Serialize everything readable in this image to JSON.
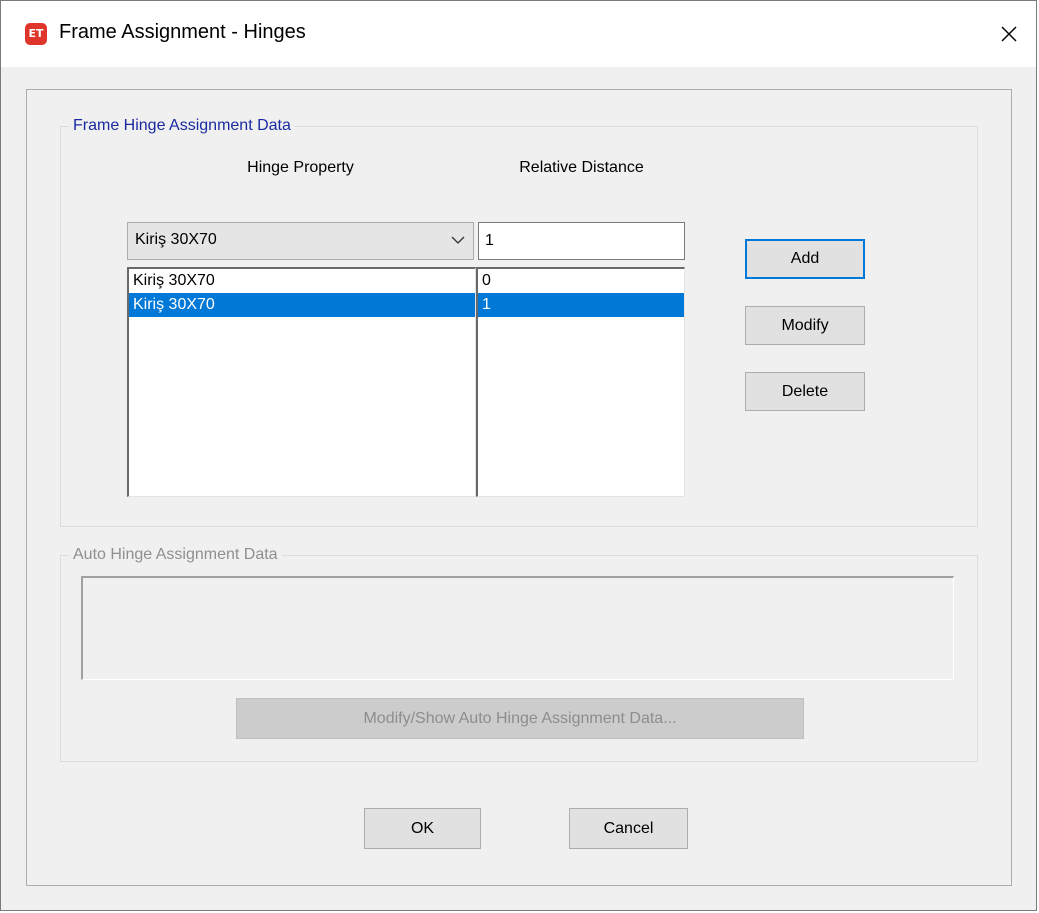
{
  "window": {
    "app_icon_text": "ET",
    "title": "Frame Assignment - Hinges",
    "close_glyph": "×"
  },
  "frame_hinge_group": {
    "legend": "Frame Hinge Assignment Data",
    "hinge_property_header": "Hinge Property",
    "relative_distance_header": "Relative Distance",
    "hinge_property_selected": "Kiriş 30X70",
    "relative_distance_value": "1",
    "rows": [
      {
        "property": "Kiriş 30X70",
        "distance": "0",
        "selected": false
      },
      {
        "property": "Kiriş 30X70",
        "distance": "1",
        "selected": true
      }
    ],
    "buttons": {
      "add": "Add",
      "modify": "Modify",
      "delete": "Delete"
    }
  },
  "auto_hinge_group": {
    "legend": "Auto Hinge Assignment Data",
    "button": "Modify/Show Auto Hinge Assignment Data..."
  },
  "footer": {
    "ok": "OK",
    "cancel": "Cancel"
  },
  "colors": {
    "selection": "#0078d7",
    "legend_blue": "#1a2aa0",
    "app_icon": "#e0352b",
    "disabled_text": "#8d8d8d"
  },
  "icons": {
    "app": "etabs-app-icon",
    "close": "close-icon",
    "dropdown": "chevron-down-icon"
  }
}
